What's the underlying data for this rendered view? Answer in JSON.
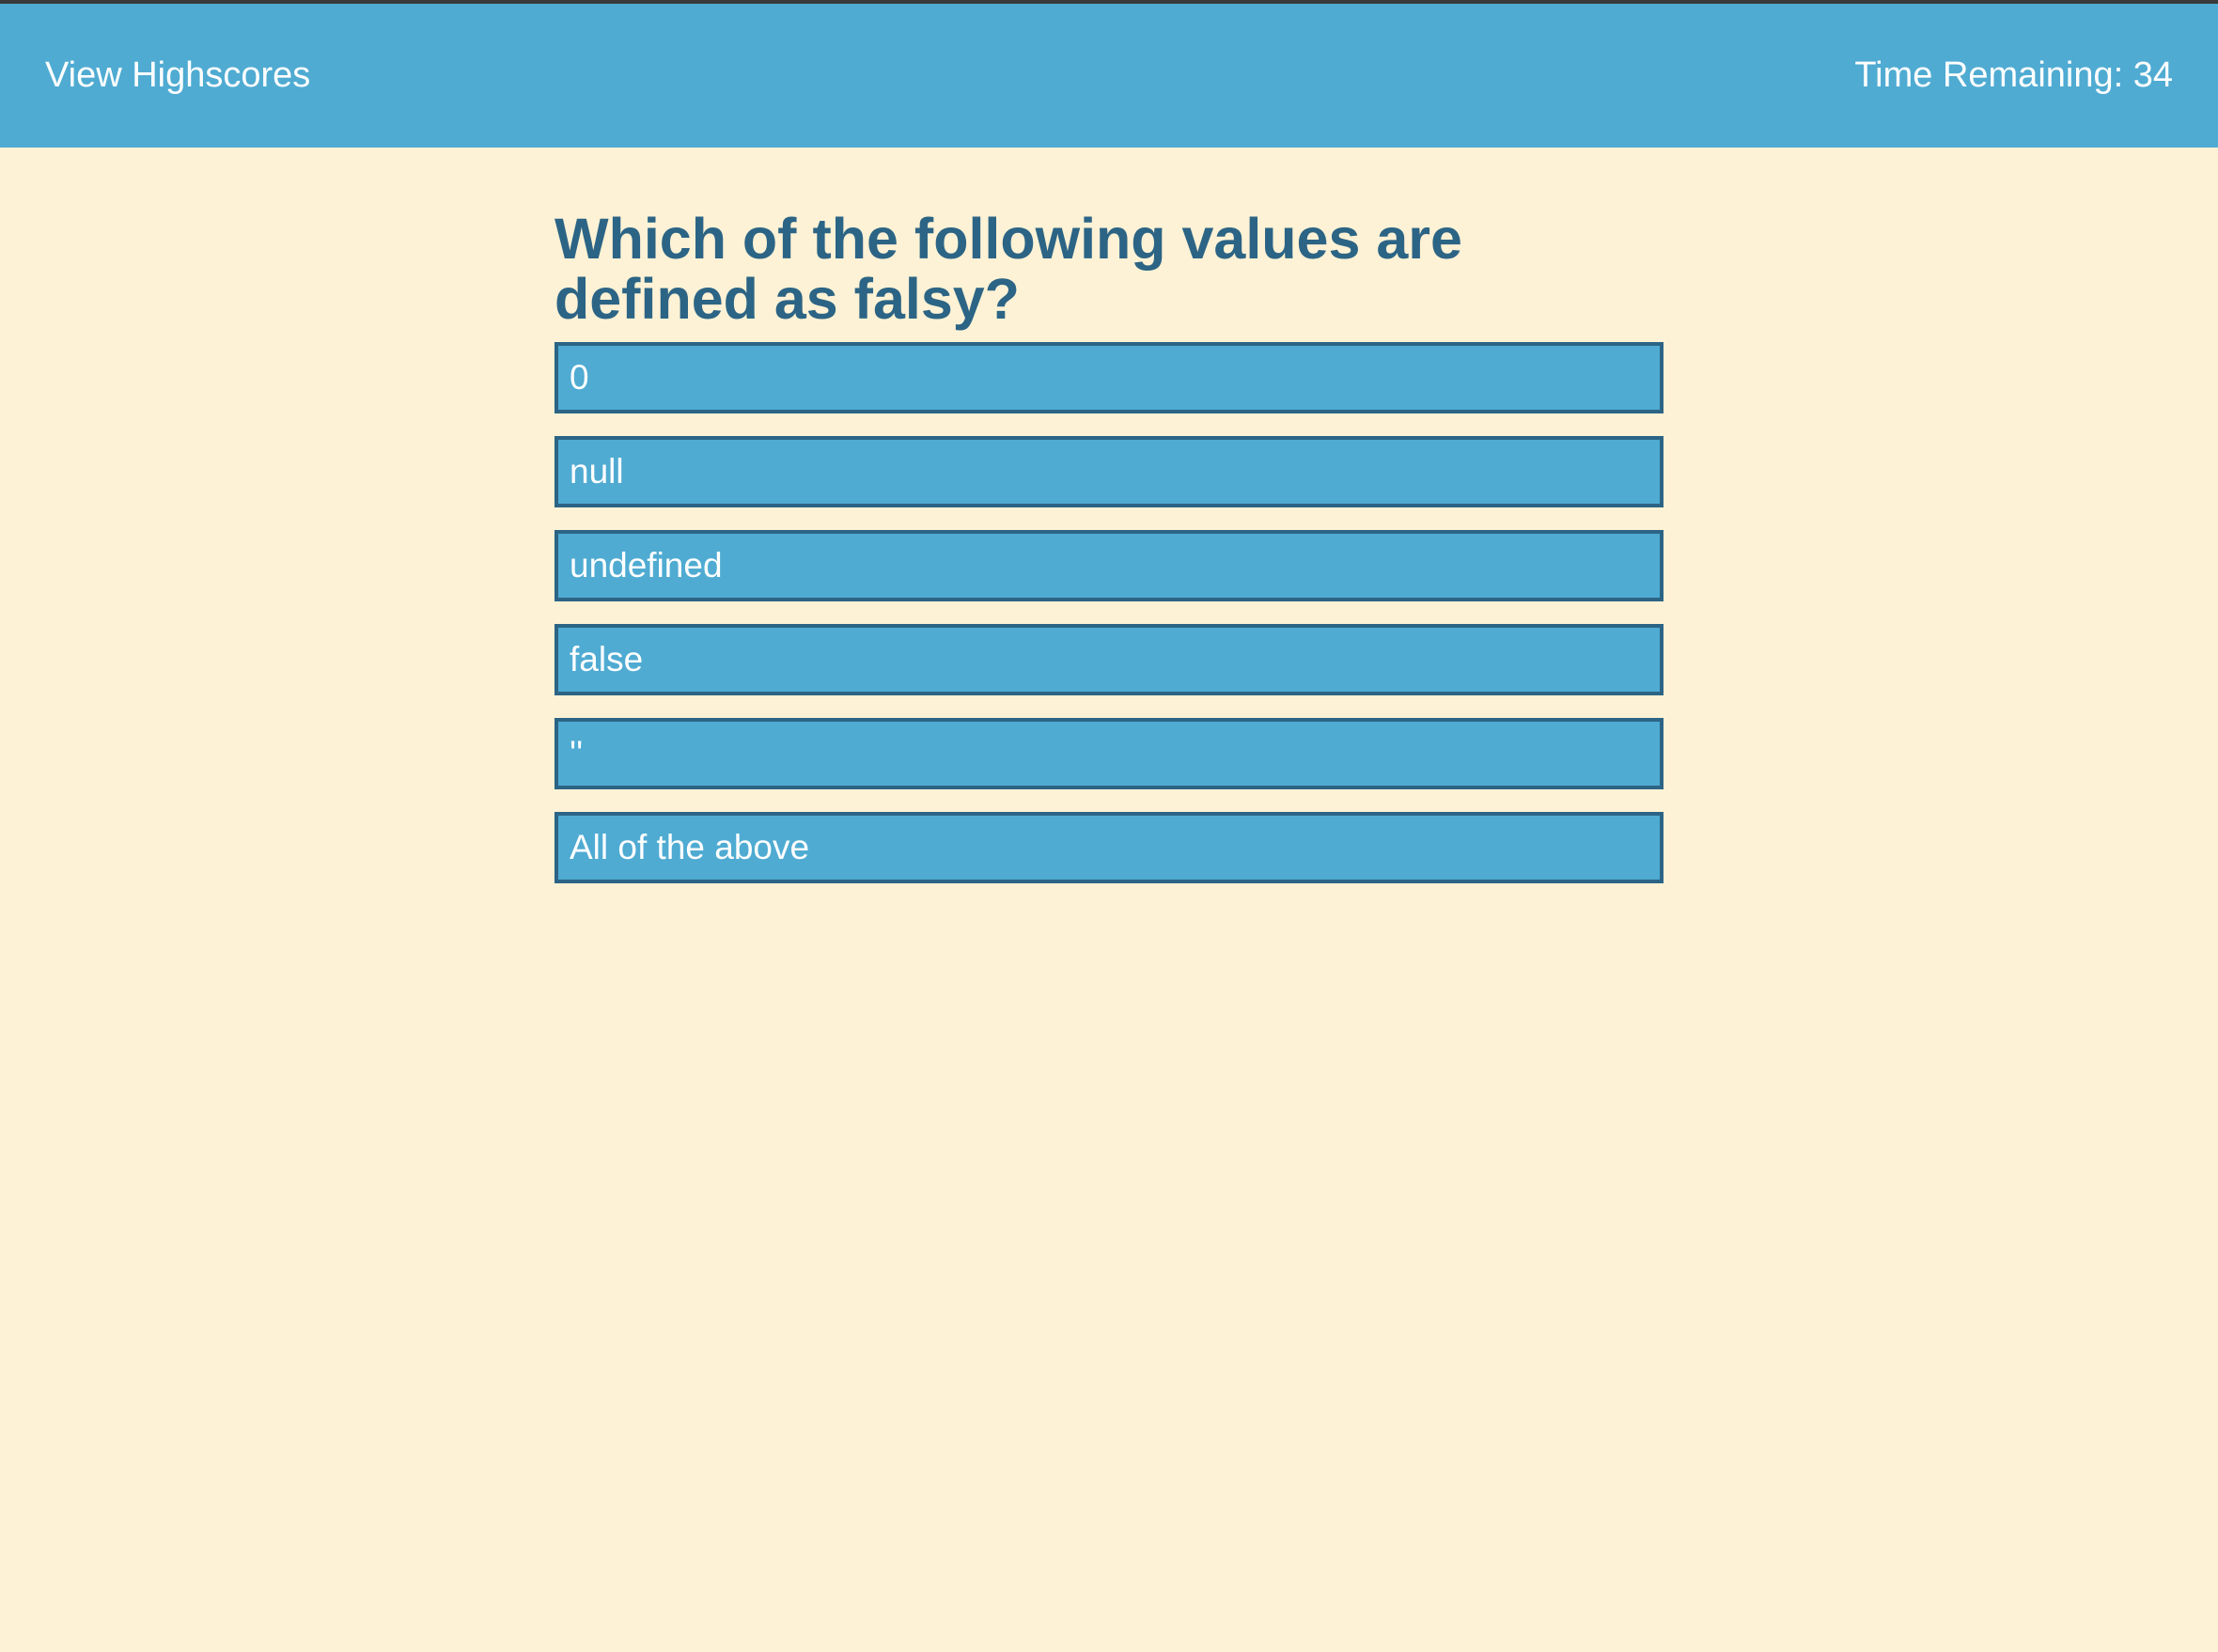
{
  "header": {
    "highscores_link": "View Highscores",
    "timer_label": "Time Remaining: ",
    "time_remaining": "34"
  },
  "question": {
    "text": "Which of the following values are defined as falsy?",
    "answers": [
      "0",
      "null",
      "undefined",
      "false",
      "''",
      "All of the above"
    ]
  },
  "colors": {
    "header_bg": "#4fabd2",
    "page_bg": "#fdf2d5",
    "accent_dark": "#2c6485",
    "button_bg": "#4fabd2"
  }
}
